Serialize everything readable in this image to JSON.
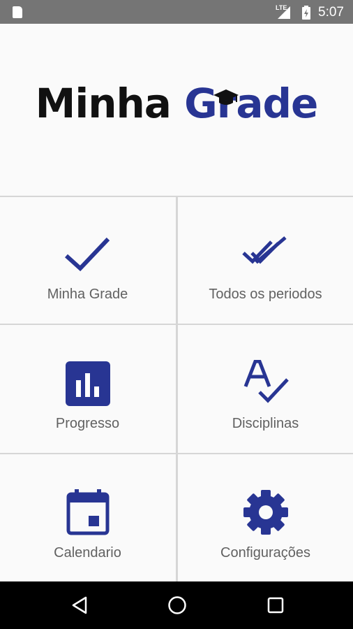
{
  "status_bar": {
    "time": "5:07",
    "network": "LTE"
  },
  "logo": {
    "word1": "Minha",
    "word2": "Grade"
  },
  "menu": [
    {
      "label": "Minha Grade",
      "icon": "check-icon"
    },
    {
      "label": "Todos os periodos",
      "icon": "double-check-icon"
    },
    {
      "label": "Progresso",
      "icon": "bar-chart-icon"
    },
    {
      "label": "Disciplinas",
      "icon": "spellcheck-icon"
    },
    {
      "label": "Calendario",
      "icon": "calendar-icon"
    },
    {
      "label": "Configurações",
      "icon": "gear-icon"
    }
  ],
  "colors": {
    "accent": "#283593",
    "status_bar": "#757575",
    "nav_bar": "#000000",
    "label_text": "#616161"
  }
}
